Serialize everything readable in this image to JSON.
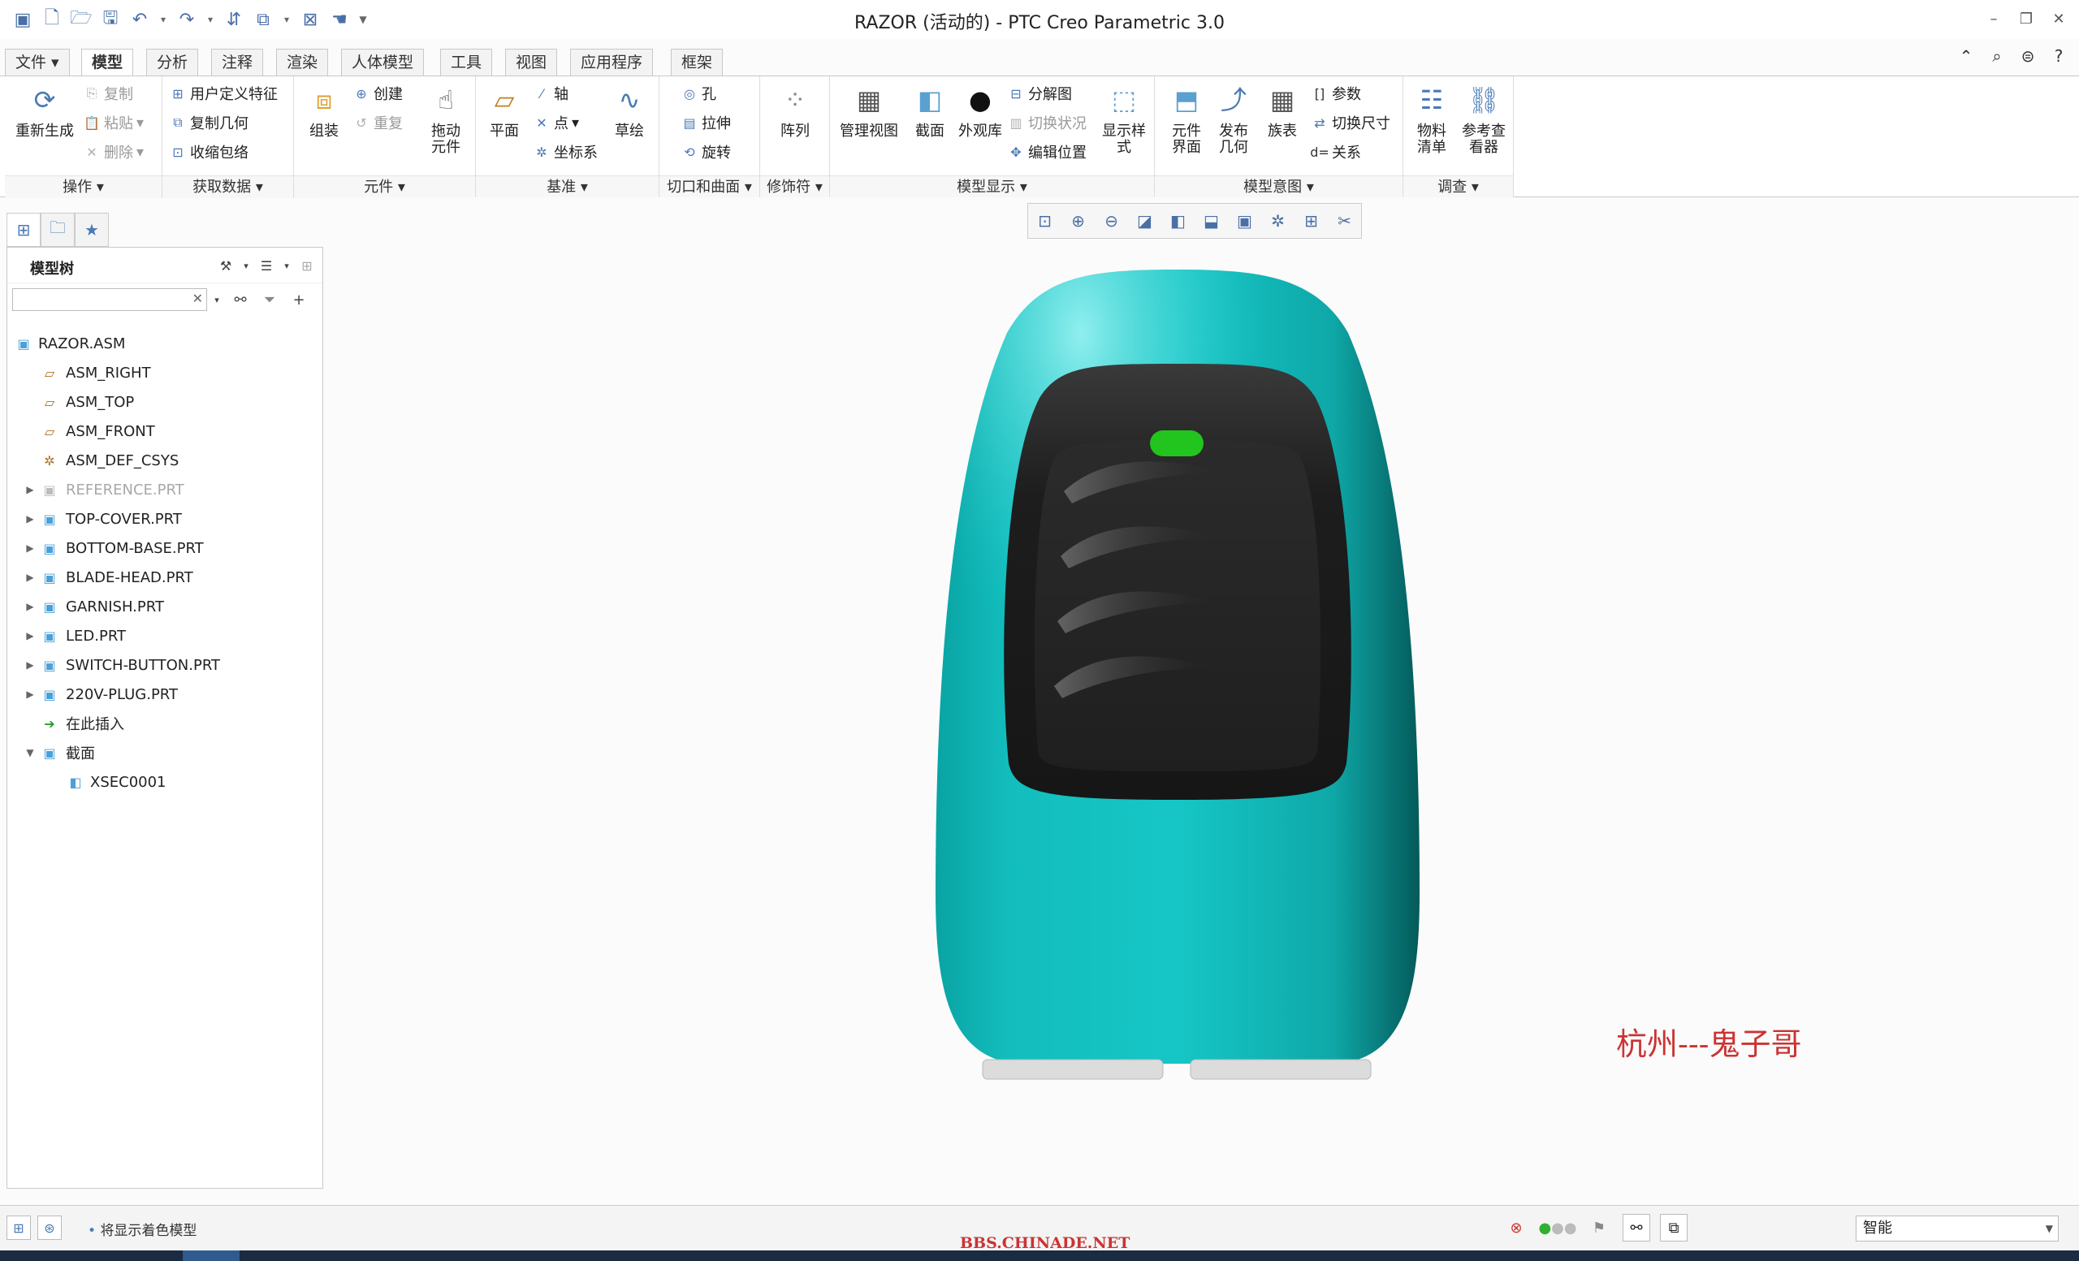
{
  "titlebar": {
    "title": "RAZOR (活动的) - PTC Creo Parametric 3.0"
  },
  "tabs": [
    {
      "label": "文件"
    },
    {
      "label": "模型"
    },
    {
      "label": "分析"
    },
    {
      "label": "注释"
    },
    {
      "label": "渲染"
    },
    {
      "label": "人体模型"
    },
    {
      "label": "工具"
    },
    {
      "label": "视图"
    },
    {
      "label": "应用程序"
    },
    {
      "label": "框架"
    }
  ],
  "ribbon": {
    "operations": {
      "label": "操作",
      "regenerate": "重新生成",
      "copy": "复制",
      "paste": "粘贴",
      "delete": "删除"
    },
    "get_data": {
      "label": "获取数据",
      "udf": "用户定义特征",
      "copy_geom": "复制几何",
      "shrinkwrap": "收缩包络"
    },
    "component": {
      "label": "元件",
      "assemble": "组装",
      "create": "创建",
      "repeat": "重复",
      "drag": "拖动元件"
    },
    "datum": {
      "label": "基准",
      "plane": "平面",
      "axis": "轴",
      "point": "点",
      "csys": "坐标系",
      "sketch": "草绘"
    },
    "cut_surface": {
      "label": "切口和曲面",
      "hole": "孔",
      "extrude": "拉伸",
      "revolve": "旋转"
    },
    "modifiers": {
      "label": "修饰符",
      "pattern": "阵列"
    },
    "model_display": {
      "label": "模型显示",
      "manage_views": "管理视图",
      "section": "截面",
      "appearance": "外观库",
      "explode": "分解图",
      "toggle_status": "切换状况",
      "edit_position": "编辑位置",
      "display_style": "显示样式"
    },
    "model_intent": {
      "label": "模型意图",
      "component_interface": "元件界面",
      "publish_geom": "发布几何",
      "family_table": "族表",
      "parameters": "参数",
      "switch_dims": "切换尺寸",
      "relations": "关系"
    },
    "investigate": {
      "label": "调查",
      "bom": "物料清单",
      "ref_viewer": "参考查看器"
    }
  },
  "model_tree": {
    "title": "模型树",
    "search_placeholder": "",
    "nodes": [
      {
        "label": "RAZOR.ASM"
      },
      {
        "label": "ASM_RIGHT"
      },
      {
        "label": "ASM_TOP"
      },
      {
        "label": "ASM_FRONT"
      },
      {
        "label": "ASM_DEF_CSYS"
      },
      {
        "label": "REFERENCE.PRT"
      },
      {
        "label": "TOP-COVER.PRT"
      },
      {
        "label": "BOTTOM-BASE.PRT"
      },
      {
        "label": "BLADE-HEAD.PRT"
      },
      {
        "label": "GARNISH.PRT"
      },
      {
        "label": "LED.PRT"
      },
      {
        "label": "SWITCH-BUTTON.PRT"
      },
      {
        "label": "220V-PLUG.PRT"
      },
      {
        "label": "在此插入"
      },
      {
        "label": "截面"
      },
      {
        "label": "XSEC0001"
      }
    ]
  },
  "graphics": {
    "watermark": "杭州---鬼子哥"
  },
  "statusbar": {
    "message": "将显示着色模型",
    "filter_value": "智能",
    "watermark": "BBS.CHINADE.NET"
  },
  "colors": {
    "model_body": "#12b5b5",
    "model_panel": "#1e1e1e",
    "led": "#22c41e",
    "watermark": "#cc3333"
  }
}
